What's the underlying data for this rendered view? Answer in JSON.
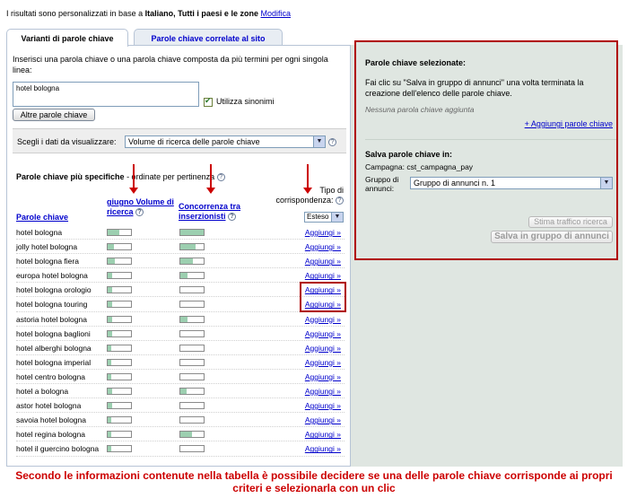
{
  "topbar": {
    "text_prefix": "I risultati sono personalizzati in base a ",
    "text_bold": "Italiano, Tutti i paesi e le zone",
    "link": "Modifica"
  },
  "tabs": [
    {
      "label": "Varianti di parole chiave",
      "active": true
    },
    {
      "label": "Parole chiave correlate al sito",
      "active": false
    }
  ],
  "left": {
    "instructions": "Inserisci una parola chiave o una parola chiave composta da più termini per ogni singola linea:",
    "keyword_value": "hotel bologna",
    "synonyms_label": "Utilizza sinonimi",
    "more_button": "Altre parole chiave",
    "choose_label": "Scegli i dati da visualizzare:",
    "choose_value": "Volume di ricerca delle parole chiave",
    "subhead_bold": "Parole chiave più specifiche",
    "subhead_rest": " - ordinate per pertinenza",
    "col_keyword": "Parole chiave",
    "col_volume": "giugno Volume di ricerca",
    "col_competition": "Concorrenza tra inserzionisti",
    "col_match": "Tipo di corrispondenza:",
    "match_value": "Esteso",
    "help_glyph": "?"
  },
  "rows": [
    {
      "kw": "hotel bologna",
      "vol": 0.5,
      "comp": 1.0,
      "add": "Aggiungi »"
    },
    {
      "kw": "jolly hotel bologna",
      "vol": 0.25,
      "comp": 0.65,
      "add": "Aggiungi »"
    },
    {
      "kw": "hotel bologna fiera",
      "vol": 0.3,
      "comp": 0.55,
      "add": "Aggiungi »"
    },
    {
      "kw": "europa hotel bologna",
      "vol": 0.2,
      "comp": 0.3,
      "add": "Aggiungi »"
    },
    {
      "kw": "hotel bologna orologio",
      "vol": 0.2,
      "comp": 0.0,
      "add": "Aggiungi »"
    },
    {
      "kw": "hotel bologna touring",
      "vol": 0.2,
      "comp": 0.0,
      "add": "Aggiungi »"
    },
    {
      "kw": "astoria hotel bologna",
      "vol": 0.2,
      "comp": 0.3,
      "add": "Aggiungi »"
    },
    {
      "kw": "hotel bologna baglioni",
      "vol": 0.2,
      "comp": 0.0,
      "add": "Aggiungi »"
    },
    {
      "kw": "hotel alberghi bologna",
      "vol": 0.15,
      "comp": 0.0,
      "add": "Aggiungi »"
    },
    {
      "kw": "hotel bologna imperial",
      "vol": 0.15,
      "comp": 0.0,
      "add": "Aggiungi »"
    },
    {
      "kw": "hotel centro bologna",
      "vol": 0.15,
      "comp": 0.0,
      "add": "Aggiungi »"
    },
    {
      "kw": "hotel a bologna",
      "vol": 0.2,
      "comp": 0.25,
      "add": "Aggiungi »"
    },
    {
      "kw": "astor hotel bologna",
      "vol": 0.2,
      "comp": 0.0,
      "add": "Aggiungi »"
    },
    {
      "kw": "savoia hotel bologna",
      "vol": 0.15,
      "comp": 0.0,
      "add": "Aggiungi »"
    },
    {
      "kw": "hotel regina bologna",
      "vol": 0.15,
      "comp": 0.5,
      "add": "Aggiungi »"
    },
    {
      "kw": "hotel il guercino bologna",
      "vol": 0.15,
      "comp": 0.0,
      "add": "Aggiungi »"
    }
  ],
  "right": {
    "title": "Parole chiave selezionate:",
    "text": "Fai clic su \"Salva in gruppo di annunci\" una volta terminata la creazione dell'elenco delle parole chiave.",
    "none_text": "Nessuna parola chiave aggiunta",
    "add_link": "+ Aggiungi parole chiave",
    "save_title": "Salva parole chiave in:",
    "campaign_label": "Campagna:",
    "campaign_value": "cst_campagna_pay",
    "group_label": "Gruppo di annunci:",
    "group_value": "Gruppo di annunci n. 1",
    "traffic_button": "Stima traffico ricerca",
    "save_button": "Salva in gruppo di annunci"
  },
  "caption": "Secondo le informazioni contenute nella tabella è possibile decidere se una delle parole chiave corrisponde ai propri criteri e selezionarla con un clic",
  "colors": {
    "accent": "#cc0000",
    "bar_fill": "#9ccfb0",
    "side_bg": "#dfe6e1"
  }
}
